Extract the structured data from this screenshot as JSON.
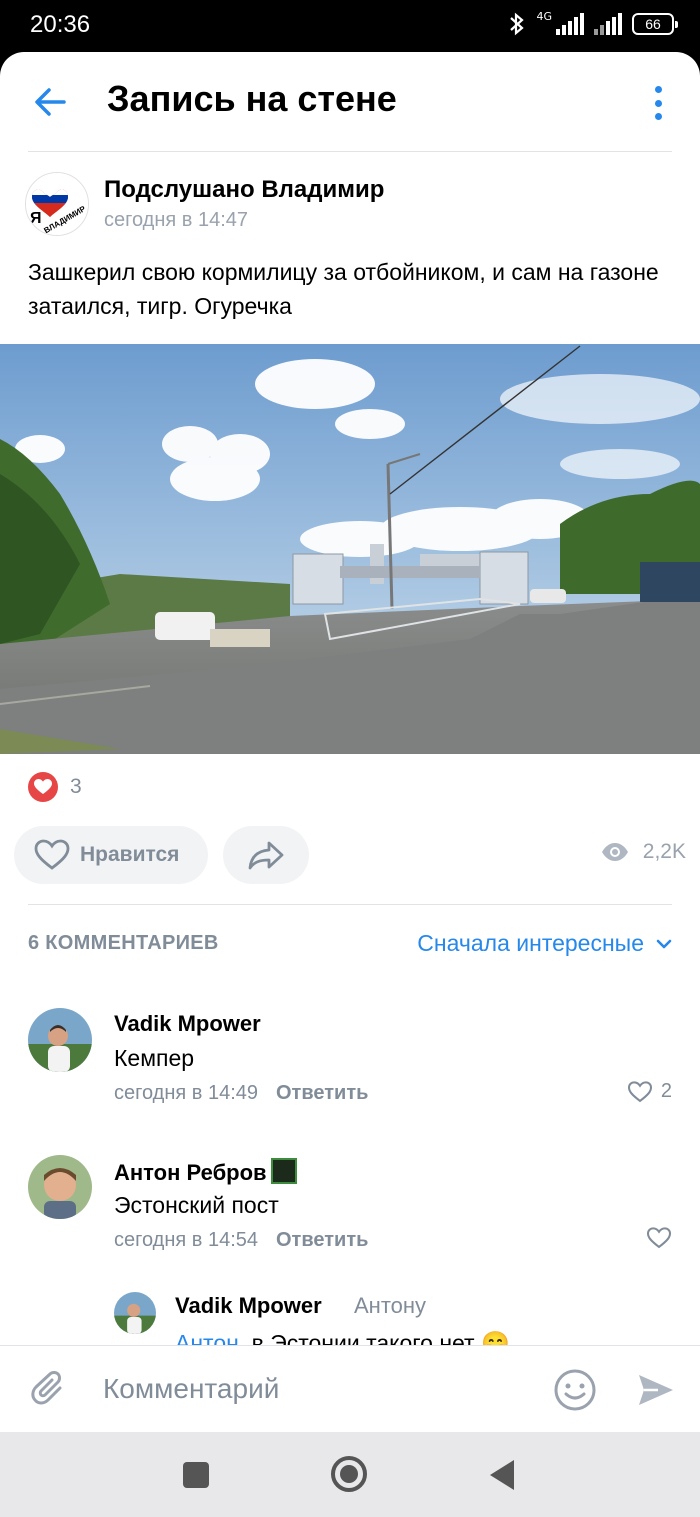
{
  "status_bar": {
    "time": "20:36",
    "network": "4G",
    "battery": "66"
  },
  "header": {
    "title": "Запись на стене",
    "back_icon": "arrow-left-icon",
    "menu_icon": "more-vertical-icon",
    "accent_color": "#2688eb"
  },
  "post": {
    "group_name": "Подслушано Владимир",
    "time": "сегодня в 14:47",
    "text": "Зашкерил свою кормилицу за отбойником, и сам на газоне затаился, тигр. Огуречка",
    "reactions_count": "3",
    "like_label": "Нравится",
    "views_count": "2,2K"
  },
  "comments": {
    "count_label": "6 КОММЕНТАРИЕВ",
    "sort_label": "Сначала интересные",
    "reply_label": "Ответить",
    "items": [
      {
        "author": "Vadik Mpower",
        "text": "Кемпер",
        "time": "сегодня в 14:49",
        "likes": "2"
      },
      {
        "author": "Антон Ребров",
        "text": "Эстонский пост",
        "time": "сегодня в 14:54",
        "likes": ""
      }
    ],
    "reply": {
      "author": "Vadik Mpower",
      "to": "Антону",
      "mention": "Антон",
      "text": ", в Эстонии такого нет 😁"
    }
  },
  "composer": {
    "placeholder": "Комментарий"
  }
}
